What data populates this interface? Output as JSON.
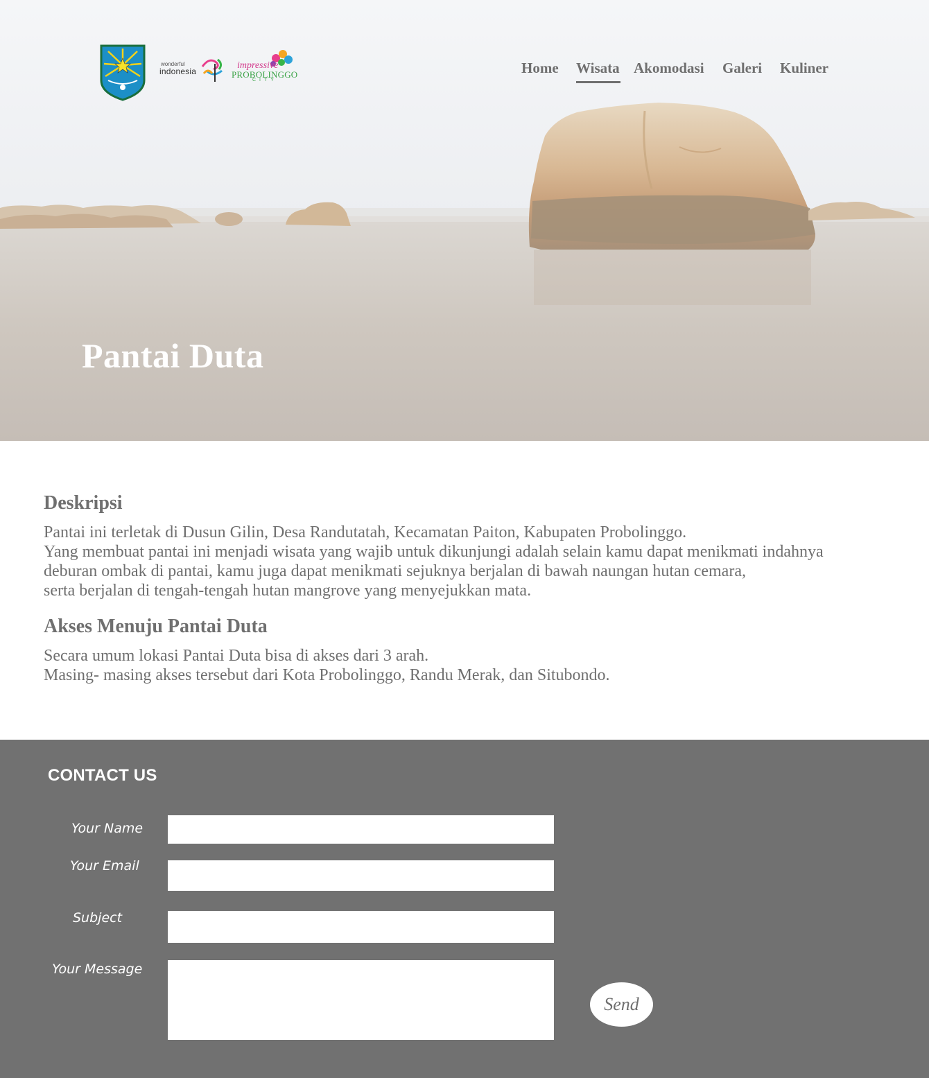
{
  "header": {
    "logos": {
      "crest": "probolinggo-crest",
      "wonderful_small": "wonderful",
      "wonderful_big": "indonesia",
      "impressive_word": "impressive",
      "impressive_city": "PROBOLINGGO",
      "impressive_sub": "CITY"
    },
    "nav": [
      {
        "label": "Home",
        "active": false
      },
      {
        "label": "Wisata",
        "active": true
      },
      {
        "label": "Akomodasi",
        "active": false
      },
      {
        "label": "Galeri",
        "active": false
      },
      {
        "label": "Kuliner",
        "active": false
      }
    ]
  },
  "hero": {
    "title": "Pantai Duta"
  },
  "content": {
    "deskripsi_heading": "Deskripsi",
    "deskripsi_lines": [
      "Pantai ini terletak di Dusun Gilin, Desa Randutatah, Kecamatan Paiton, Kabupaten Probolinggo.",
      "Yang membuat pantai ini menjadi wisata yang wajib untuk dikunjungi adalah selain kamu dapat menikmati indahnya",
      "deburan ombak di pantai, kamu juga dapat menikmati sejuknya berjalan di bawah naungan hutan cemara,",
      "serta berjalan di tengah-tengah hutan mangrove yang menyejukkan mata."
    ],
    "akses_heading": "Akses Menuju Pantai Duta",
    "akses_lines": [
      "Secara umum lokasi Pantai Duta bisa di akses dari 3 arah.",
      "Masing- masing akses tersebut dari Kota Probolinggo, Randu Merak, dan Situbondo."
    ]
  },
  "contact": {
    "title": "CONTACT US",
    "name_label": "Your Name",
    "email_label": "Your Email",
    "subject_label": "Subject",
    "message_label": "Your Message",
    "name_value": "",
    "email_value": "",
    "subject_value": "",
    "message_value": "",
    "send_label": "Send"
  },
  "colors": {
    "text_gray": "#6f6f6f",
    "footer_bg": "#717171",
    "white": "#ffffff"
  }
}
